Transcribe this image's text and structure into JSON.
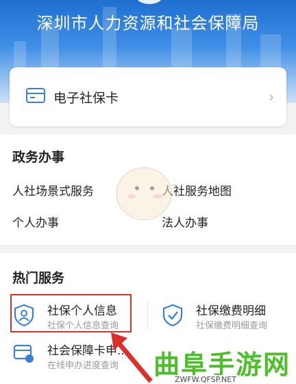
{
  "banner": {
    "title": "深圳市人力资源和社会保障局"
  },
  "card": {
    "label": "电子社保卡",
    "chevron": "›"
  },
  "gov_affairs": {
    "title": "政务办事",
    "items": [
      "人社场景式服务",
      "人社服务地图",
      "个人办事",
      "法人办事"
    ]
  },
  "hot_services": {
    "title": "热门服务",
    "items": [
      {
        "title": "社保个人信息",
        "subtitle": "社保个人信息查询",
        "icon": "person-shield-icon"
      },
      {
        "title": "社保缴费明细",
        "subtitle": "社保缴费明细查询",
        "icon": "check-shield-icon"
      },
      {
        "title": "社会保障卡申...",
        "subtitle": "在线申办进度查询",
        "icon": "card-progress-icon"
      }
    ]
  },
  "watermark": {
    "text": "曲阜手游网",
    "url": "ZWFW.QFSP.NET"
  },
  "colors": {
    "banner": "#2f7fdc",
    "icon": "#3a7fd8",
    "highlight": "#d9302c",
    "watermark": "#4cbf2a"
  }
}
